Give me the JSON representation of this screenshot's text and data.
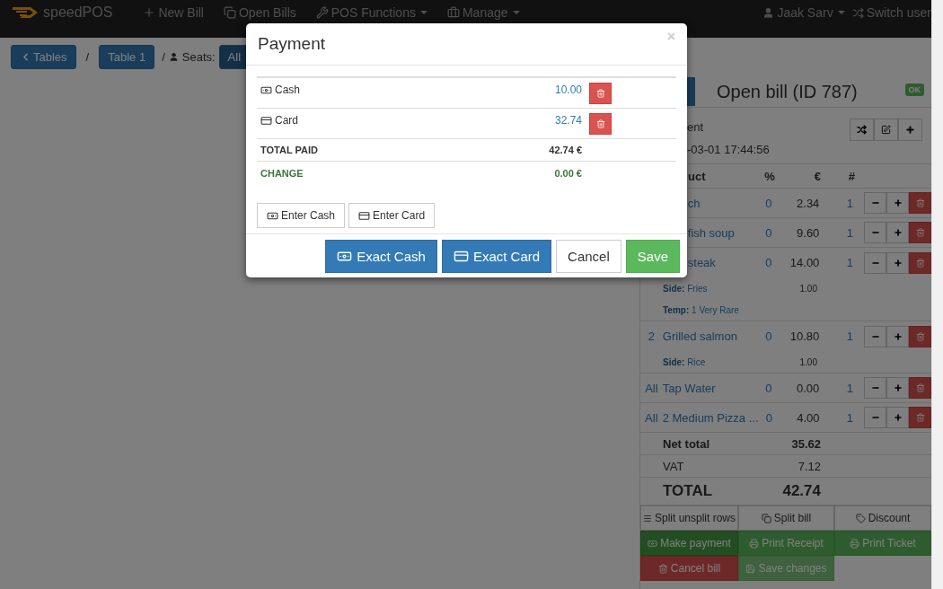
{
  "navbar": {
    "brand": "speedPOS",
    "items": [
      {
        "label": "New Bill",
        "dropdown": false
      },
      {
        "label": "Open Bills",
        "dropdown": false
      },
      {
        "label": "POS Functions",
        "dropdown": true
      },
      {
        "label": "Manage",
        "dropdown": true
      }
    ],
    "user": {
      "label": "Jaak Sarv",
      "dropdown": true
    },
    "switch_user": "Switch user"
  },
  "toolbar": {
    "tables": "Tables",
    "separator": "/",
    "table": "Table 1",
    "seats_prefix": "/",
    "seats_label": "Seats:",
    "seats": [
      {
        "label": "All",
        "selected": true
      }
    ]
  },
  "bill": {
    "title": "Open bill (ID 787)",
    "status": "OK",
    "client": "ent",
    "date": "-03-01 17:44:56",
    "columns": [
      "uct",
      "%",
      "€",
      "#"
    ],
    "items": [
      {
        "name": "ch",
        "discount": "0",
        "price": "2.34",
        "qty": "1",
        "clipped": true
      },
      {
        "name": "fish soup",
        "discount": "0",
        "price": "9.60",
        "qty": "1",
        "clipped": true
      },
      {
        "name": "steak",
        "discount": "0",
        "price": "14.00",
        "qty": "1",
        "clipped": true,
        "modifiers": [
          {
            "text": "**Side:** Fries",
            "price": "1.00"
          },
          {
            "text": "**Temp:** 1 Very Rare"
          }
        ]
      },
      {
        "seat": "2",
        "name": "Grilled salmon",
        "discount": "0",
        "price": "10.80",
        "qty": "1",
        "clipped": false,
        "modifiers": [
          {
            "text": "**Side:** Rice",
            "price": "1.00"
          }
        ]
      },
      {
        "seat": "All",
        "name": "Tap Water",
        "discount": "0",
        "price": "0.00",
        "qty": "1",
        "clipped": false
      },
      {
        "seat": "All",
        "name": "2 Medium Pizza ...",
        "discount": "0",
        "price": "4.00",
        "qty": "1",
        "clipped": false
      }
    ],
    "totals": [
      {
        "label": "Net total",
        "value": "35.62",
        "kind": "net"
      },
      {
        "label": "VAT",
        "value": "7.12",
        "kind": "vat"
      },
      {
        "label": "TOTAL",
        "value": "42.74",
        "kind": "grand"
      }
    ],
    "actions": [
      {
        "label": "Split unsplit rows",
        "kind": "default",
        "active": false,
        "disabled": false
      },
      {
        "label": "Split bill",
        "kind": "default",
        "active": false,
        "disabled": false
      },
      {
        "label": "Discount",
        "kind": "default",
        "active": false,
        "disabled": false
      },
      {
        "label": "Make payment",
        "kind": "success",
        "active": true,
        "disabled": false
      },
      {
        "label": "Print Receipt",
        "kind": "success",
        "active": false,
        "disabled": false
      },
      {
        "label": "Print Ticket",
        "kind": "success",
        "active": false,
        "disabled": false
      },
      {
        "label": "Cancel bill",
        "kind": "danger",
        "active": false,
        "disabled": false
      },
      {
        "label": "Save changes",
        "kind": "success",
        "active": false,
        "disabled": true
      }
    ]
  },
  "payment_dialog": {
    "title": "Payment",
    "close": "×",
    "payments": [
      {
        "method": "Cash",
        "amount": "10.00"
      },
      {
        "method": "Card",
        "amount": "32.74"
      }
    ],
    "summary": [
      {
        "label": "TOTAL PAID",
        "value": "42.74 €",
        "kind": "total"
      },
      {
        "label": "CHANGE",
        "value": "0.00 €",
        "kind": "change"
      }
    ],
    "enter_buttons": [
      "Enter Cash",
      "Enter Card"
    ],
    "footer_buttons": [
      {
        "label": "Exact Cash",
        "kind": "primary"
      },
      {
        "label": "Exact Card",
        "kind": "primary"
      },
      {
        "label": "Cancel",
        "kind": "default"
      },
      {
        "label": "Save",
        "kind": "success"
      }
    ]
  }
}
